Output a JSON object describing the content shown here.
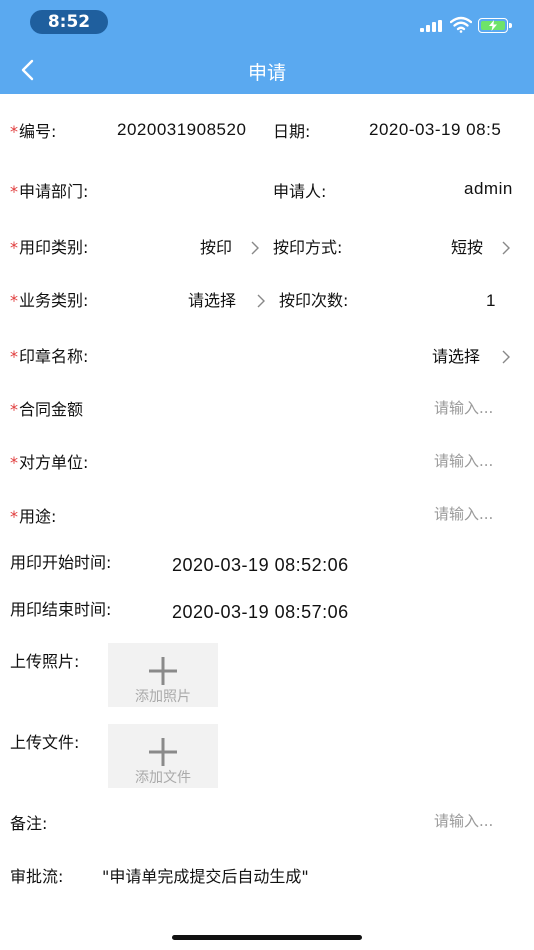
{
  "status_bar": {
    "time": "8:52"
  },
  "nav": {
    "title": "申请"
  },
  "form": {
    "number_label": "编号:",
    "number_value": "2020031908520",
    "date_label": "日期:",
    "date_value": "2020-03-19 08:5",
    "dept_label": "申请部门:",
    "applicant_label": "申请人:",
    "applicant_value": "admin",
    "seal_type_label": "用印类别:",
    "seal_type_value": "按印",
    "press_mode_label": "按印方式:",
    "press_mode_value": "短按",
    "biz_type_label": "业务类别:",
    "biz_type_value": "请选择",
    "press_count_label": "按印次数:",
    "press_count_value": "1",
    "seal_name_label": "印章名称:",
    "seal_name_value": "请选择",
    "contract_amount_label": "合同金额",
    "contract_amount_placeholder": "请输入...",
    "counterparty_label": "对方单位:",
    "counterparty_placeholder": "请输入...",
    "purpose_label": "用途:",
    "purpose_placeholder": "请输入...",
    "start_time_label": "用印开始时间:",
    "start_time_value": "2020-03-19 08:52:06",
    "end_time_label": "用印结束时间:",
    "end_time_value": "2020-03-19 08:57:06",
    "upload_photo_label": "上传照片:",
    "add_photo_label": "添加照片",
    "upload_file_label": "上传文件:",
    "add_file_label": "添加文件",
    "remark_label": "备注:",
    "remark_placeholder": "请输入...",
    "approval_label": "审批流:",
    "approval_value": "\"申请单完成提交后自动生成\""
  },
  "icons": {
    "back": "chevron-left-icon",
    "chevron": "chevron-right-icon",
    "plus": "plus-icon"
  },
  "colors": {
    "header": "#5aa9f0",
    "required": "#e03b3b",
    "placeholder": "#9a9a9a"
  }
}
